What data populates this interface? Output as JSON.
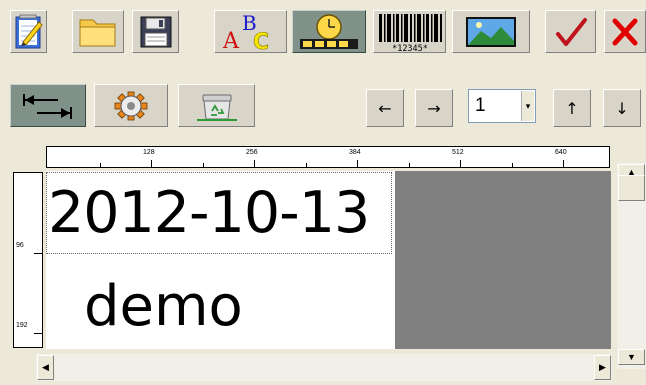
{
  "toolbar1": {
    "buttons": [
      {
        "name": "new-document-button",
        "icon": "notepad-pencil-icon"
      },
      {
        "name": "open-folder-button",
        "icon": "folder-icon"
      },
      {
        "name": "save-button",
        "icon": "floppy-disk-icon"
      },
      {
        "name": "insert-text-button",
        "icon": "abc-letters-icon",
        "glyphs": [
          "B",
          "A",
          "C"
        ]
      },
      {
        "name": "insert-datetime-button",
        "icon": "clock-calendar-icon"
      },
      {
        "name": "insert-barcode-button",
        "icon": "barcode-icon",
        "caption": "*12345*"
      },
      {
        "name": "insert-image-button",
        "icon": "landscape-picture-icon"
      },
      {
        "name": "confirm-button",
        "icon": "checkmark-icon"
      },
      {
        "name": "close-button",
        "icon": "x-close-icon"
      }
    ]
  },
  "toolbar2": {
    "buttons": [
      {
        "name": "align-arrows-button",
        "icon": "bidirectional-arrows-icon"
      },
      {
        "name": "settings-button",
        "icon": "gear-icon"
      },
      {
        "name": "recycle-button",
        "icon": "recycle-bin-icon"
      }
    ],
    "nav": {
      "left_arrow": "←",
      "right_arrow": "→",
      "up_arrow": "↑",
      "down_arrow": "↓"
    },
    "page_spinner": {
      "value": "1",
      "dropdown_glyph": "▾"
    }
  },
  "ruler": {
    "horizontal_labels": [
      "128",
      "256",
      "384",
      "512",
      "640"
    ],
    "vertical_labels": [
      "96",
      "192"
    ]
  },
  "canvas": {
    "date_text": "2012-10-13",
    "demo_text": "demo"
  },
  "scrollbars": {
    "up_glyph": "▲",
    "down_glyph": "▼",
    "left_glyph": "◀",
    "right_glyph": "▶"
  },
  "colors": {
    "window_bg": "#ece9d8",
    "canvas_gray": "#808080",
    "check_red": "#c0141c",
    "close_red": "#e00000"
  }
}
